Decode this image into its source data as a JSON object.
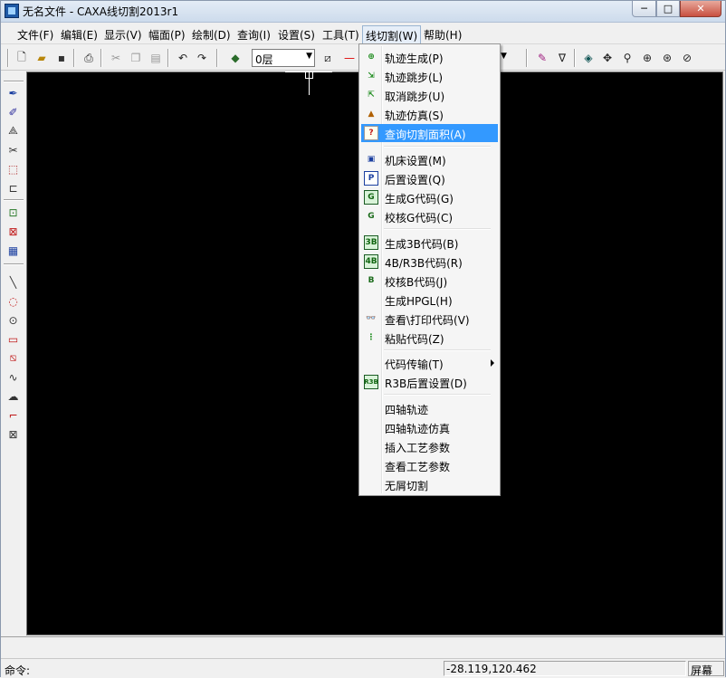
{
  "window": {
    "title": "无名文件 - CAXA线切割2013r1",
    "min_symbol": "─",
    "max_symbol": "□",
    "close_symbol": "✕"
  },
  "menubar": {
    "items": [
      "文件(F)",
      "编辑(E)",
      "显示(V)",
      "幅面(P)",
      "绘制(D)",
      "查询(I)",
      "设置(S)",
      "工具(T)",
      "线切割(W)",
      "帮助(H)"
    ]
  },
  "toolbar": {
    "layer": "0层",
    "icons": [
      "new-file",
      "open-folder",
      "save",
      "print",
      "cut",
      "copy",
      "paste",
      "undo",
      "redo",
      "layer-stack",
      "line-style",
      "eraser",
      "filter",
      "region-fill",
      "pan",
      "zoom-dynamic",
      "zoom-window",
      "zoom-all",
      "zoom-previous"
    ]
  },
  "left_toolbar": {
    "icons": [
      "pen",
      "brush",
      "dimension",
      "scissors",
      "block",
      "tag",
      "chain-a",
      "text-xxx",
      "edit-doc",
      "line",
      "arc-center",
      "circle",
      "rectangle",
      "hatch",
      "spline",
      "cloud",
      "polyline-corner",
      "cross-hatch"
    ]
  },
  "dropdown": {
    "items": [
      {
        "label": "轨迹生成(P)",
        "icon": "track-gen-icon",
        "glyph": "⊕"
      },
      {
        "label": "轨迹跳步(L)",
        "icon": "track-jump-icon",
        "glyph": "⇲"
      },
      {
        "label": "取消跳步(U)",
        "icon": "cancel-jump-icon",
        "glyph": "⇱"
      },
      {
        "label": "轨迹仿真(S)",
        "icon": "track-sim-icon",
        "glyph": "▲"
      },
      {
        "label": "查询切割面积(A)",
        "icon": "query-area-icon",
        "glyph": "?",
        "highlight": true
      },
      {
        "label": "机床设置(M)",
        "icon": "machine-icon",
        "glyph": "▣"
      },
      {
        "label": "后置设置(Q)",
        "icon": "post-icon",
        "glyph": "P"
      },
      {
        "label": "生成G代码(G)",
        "icon": "gcode-icon",
        "glyph": "G"
      },
      {
        "label": "校核G代码(C)",
        "icon": "check-gcode-icon",
        "glyph": "G"
      },
      {
        "label": "生成3B代码(B)",
        "icon": "code3b-icon",
        "glyph": "3B"
      },
      {
        "label": "4B/R3B代码(R)",
        "icon": "code4b-icon",
        "glyph": "4B"
      },
      {
        "label": "校核B代码(J)",
        "icon": "check-bcode-icon",
        "glyph": "B"
      },
      {
        "label": "生成HPGL(H)",
        "icon": "",
        "glyph": ""
      },
      {
        "label": "查看\\打印代码(V)",
        "icon": "glasses-icon",
        "glyph": "👓"
      },
      {
        "label": "粘贴代码(Z)",
        "icon": "paste-code-icon",
        "glyph": "⋮"
      },
      {
        "label": "代码传输(T)",
        "icon": "",
        "glyph": "",
        "submenu": true
      },
      {
        "label": "R3B后置设置(D)",
        "icon": "r3b-icon",
        "glyph": "R3B"
      },
      {
        "label": "四轴轨迹",
        "icon": "",
        "glyph": ""
      },
      {
        "label": "四轴轨迹仿真",
        "icon": "",
        "glyph": ""
      },
      {
        "label": "插入工艺参数",
        "icon": "",
        "glyph": ""
      },
      {
        "label": "查看工艺参数",
        "icon": "",
        "glyph": ""
      },
      {
        "label": "无屑切割",
        "icon": "",
        "glyph": ""
      }
    ]
  },
  "status": {
    "command_label": "命令:",
    "coordinates": "-28.119,120.462",
    "screen_mode": "屏幕"
  }
}
